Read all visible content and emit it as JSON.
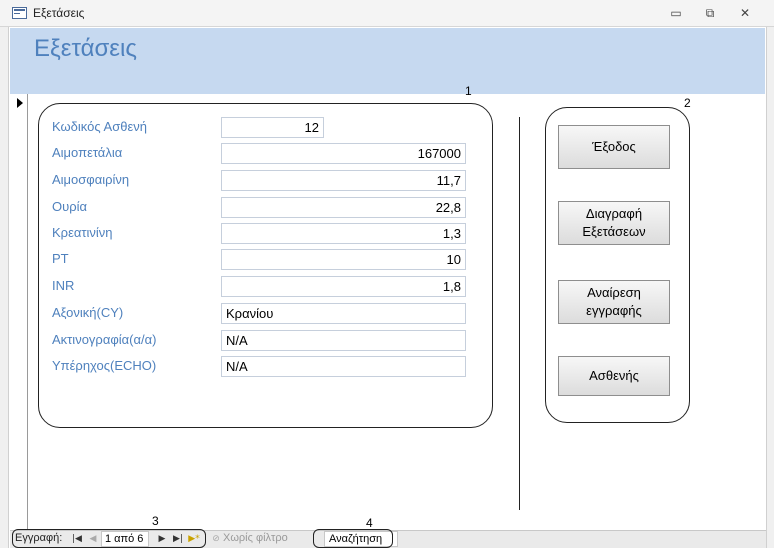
{
  "window": {
    "title": "Εξετάσεις",
    "controls": {
      "minimize": "▭",
      "restore": "⧉",
      "close": "✕"
    }
  },
  "form": {
    "header_title": "Εξετάσεις",
    "fields": [
      {
        "label": "Κωδικός Ασθενή",
        "value": "12"
      },
      {
        "label": "Αιμοπετάλια",
        "value": "167000"
      },
      {
        "label": "Αιμοσφαιρίνη",
        "value": "11,7"
      },
      {
        "label": "Ουρία",
        "value": "22,8"
      },
      {
        "label": "Κρεατινίνη",
        "value": "1,3"
      },
      {
        "label": "PT",
        "value": "10"
      },
      {
        "label": "INR",
        "value": "1,8"
      },
      {
        "label": "Αξονική(CY)",
        "value": "Κρανίου"
      },
      {
        "label": "Ακτινογραφία(α/α)",
        "value": "N/A"
      },
      {
        "label": "Υπέρηχος(ECHO)",
        "value": "N/A"
      }
    ],
    "buttons": {
      "exit": "Έξοδος",
      "delete_exams": "Διαγραφή\nΕξετάσεων",
      "remove_record": "Αναίρεση\nεγγραφής",
      "patient": "Ασθενής"
    }
  },
  "annotations": {
    "a1": "1",
    "a2": "2",
    "a3": "3",
    "a4": "4"
  },
  "navigation": {
    "record_label": "Εγγραφή:",
    "position": "1 από 6",
    "filter": "Χωρίς φίλτρο",
    "search": "Αναζήτηση"
  },
  "colors": {
    "accent": "#4f81bd",
    "header_bg": "#c6d9f0"
  },
  "icons": [
    "form-icon",
    "first-record-icon",
    "previous-record-icon",
    "next-record-icon",
    "last-record-icon",
    "new-record-icon",
    "filter-icon",
    "record-selector-icon"
  ]
}
